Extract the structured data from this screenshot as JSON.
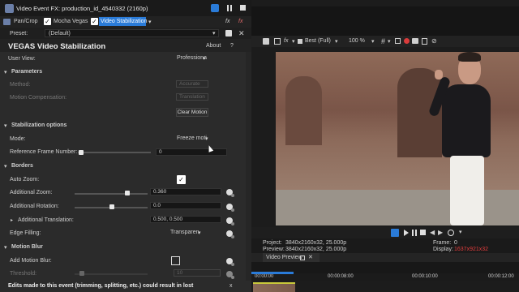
{
  "window": {
    "title": "Video Event FX: production_id_4540332 (2160p)"
  },
  "chain": {
    "items": [
      {
        "label": "Pan/Crop"
      },
      {
        "label": "Mocha Vegas"
      },
      {
        "label": "Video Stabilization"
      }
    ],
    "fx_label": "fx",
    "fx_label2": "fx"
  },
  "preset": {
    "label": "Preset:",
    "value": "(Default)"
  },
  "plugin": {
    "name": "VEGAS Video Stabilization",
    "about_label": "About",
    "help_label": "?"
  },
  "user_view": {
    "label": "User View:",
    "value": "Professiona"
  },
  "parameters": {
    "title": "Parameters",
    "method_label": "Method:",
    "method_value": "Accurate",
    "motion_comp_label": "Motion Compensation:",
    "motion_comp_value": "Translation",
    "clear_motion_label": "Clear Motion"
  },
  "stabilization": {
    "title": "Stabilization options",
    "mode_label": "Mode:",
    "mode_value": "Freeze moti",
    "ref_label": "Reference Frame Number:",
    "ref_value": "0"
  },
  "borders": {
    "title": "Borders",
    "auto_zoom_label": "Auto Zoom:",
    "add_zoom_label": "Additional Zoom:",
    "add_zoom_value": "0.360",
    "add_zoom_level": 0.36,
    "add_rot_label": "Additional Rotation:",
    "add_rot_value": "0.0",
    "add_trans_label": "Additional Translation:",
    "add_trans_value": "0.500, 0.500",
    "edge_label": "Edge Filling:",
    "edge_value": "Transparen"
  },
  "motion_blur": {
    "title": "Motion Blur",
    "add_label": "Add Motion Blur:",
    "threshold_label": "Threshold:",
    "threshold_value": "10"
  },
  "warning": {
    "text": "Edits made to this event (trimming, splitting, etc.) could result in lost",
    "close_label": "x"
  },
  "preview_toolbar": {
    "quality": "Best (Full)",
    "zoom": "100 %"
  },
  "info": {
    "project_label": "Project:",
    "project_value": "3840x2160x32, 25.000p",
    "preview_label": "Preview:",
    "preview_value": "3840x2160x32, 25.000p",
    "frame_label": "Frame:",
    "frame_value": "0",
    "display_label": "Display:",
    "display_value": "1637x921x32"
  },
  "tabs": {
    "video_preview": "Video Preview"
  },
  "ruler": {
    "t1": "00:00:00",
    "t2": "00:00:08:00",
    "t3": "00:00:10:00",
    "t4": "00:00:12:00"
  },
  "colors": {
    "accent": "#2a7bd8",
    "display_value": "#e23d3d"
  }
}
